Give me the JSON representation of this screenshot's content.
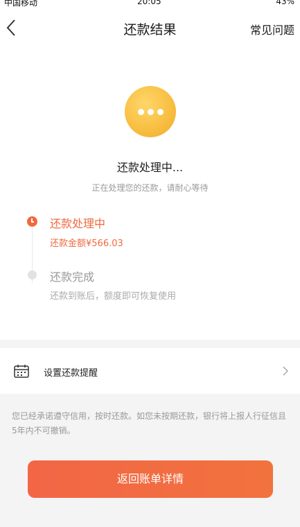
{
  "status_bar": {
    "carrier": "中国移动",
    "time": "20:05",
    "battery": "43%"
  },
  "nav": {
    "title": "还款结果",
    "faq_label": "常见问题"
  },
  "status": {
    "icon": "processing-dots-icon",
    "title": "还款处理中...",
    "subtitle": "正在处理您的还款，请耐心等待"
  },
  "timeline": {
    "steps": [
      {
        "title": "还款处理中",
        "detail": "还款金额¥566.03",
        "state": "active"
      },
      {
        "title": "还款完成",
        "detail": "还款到账后，额度即可恢复使用",
        "state": "pending"
      }
    ]
  },
  "reminder": {
    "icon": "calendar-icon",
    "label": "设置还款提醒"
  },
  "notice": "您已经承诺遵守信用，按时还款。如您未按期还款，银行将上报人行征信且5年内不可撤销。",
  "action": {
    "return_label": "返回账单详情"
  },
  "colors": {
    "accent": "#f0693f",
    "status_circle": "#f8c043",
    "pending": "#e2e2e2"
  }
}
